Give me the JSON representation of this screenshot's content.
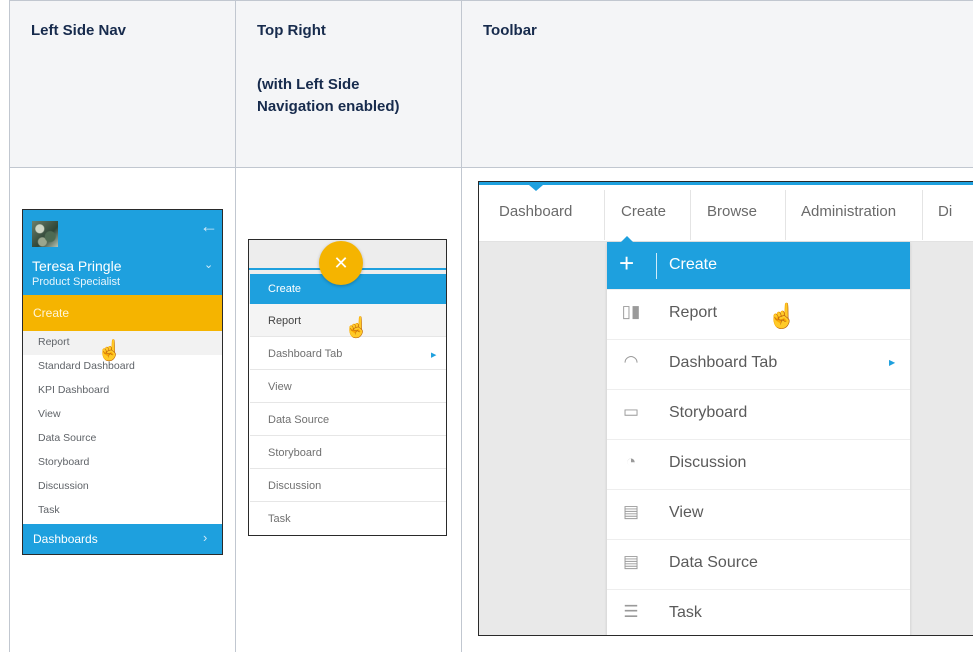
{
  "table": {
    "col1_header": "Left Side Nav",
    "col2_header_line1": "Top Right",
    "col2_header_line2": "(with Left Side Navigation enabled)",
    "col3_header": "Toolbar"
  },
  "left_nav": {
    "user_name": "Teresa Pringle",
    "user_role": "Product Specialist",
    "create_label": "Create",
    "items": [
      "Report",
      "Standard Dashboard",
      "KPI Dashboard",
      "View",
      "Data Source",
      "Storyboard",
      "Discussion",
      "Task"
    ],
    "dashboards_label": "Dashboards",
    "colors": {
      "header": "#1ea0de",
      "create": "#f5b400"
    }
  },
  "top_right": {
    "create_label": "Create",
    "items": [
      "Report",
      "Dashboard Tab",
      "View",
      "Data Source",
      "Storyboard",
      "Discussion",
      "Task"
    ]
  },
  "toolbar": {
    "tabs": [
      "Dashboard",
      "Create",
      "Browse",
      "Administration",
      "Di"
    ],
    "create_label": "Create",
    "items": [
      {
        "label": "Report",
        "icon": "bar-chart-icon"
      },
      {
        "label": "Dashboard Tab",
        "icon": "gauge-icon"
      },
      {
        "label": "Storyboard",
        "icon": "storyboard-icon"
      },
      {
        "label": "Discussion",
        "icon": "discussion-icon"
      },
      {
        "label": "View",
        "icon": "view-icon"
      },
      {
        "label": "Data Source",
        "icon": "data-source-icon"
      },
      {
        "label": "Task",
        "icon": "task-list-icon"
      }
    ]
  }
}
